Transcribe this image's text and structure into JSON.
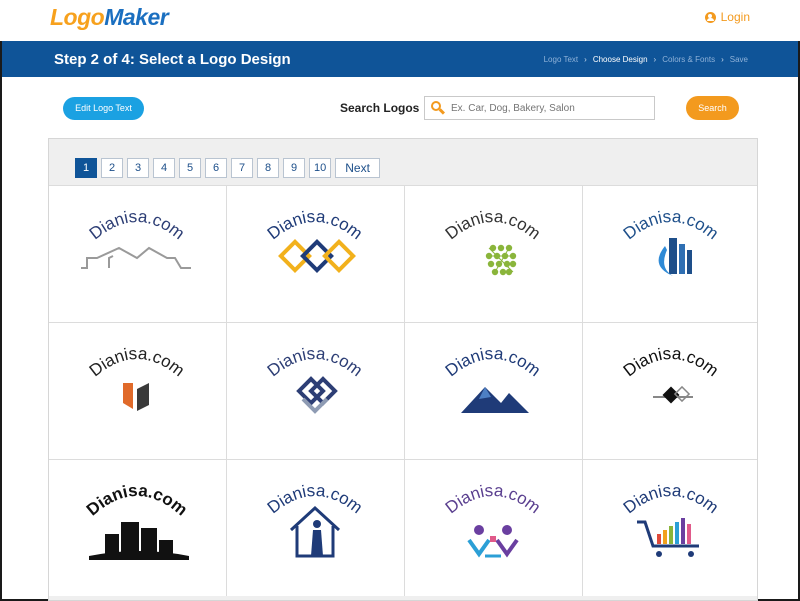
{
  "header": {
    "logo_part1": "Logo",
    "logo_part2": "Maker",
    "login_label": "Login"
  },
  "banner": {
    "title": "Step 2 of 4: Select a Logo Design",
    "steps": [
      "Logo Text",
      "Choose Design",
      "Colors & Fonts",
      "Save"
    ],
    "active_step": "Choose Design"
  },
  "toolbar": {
    "edit_label": "Edit Logo Text",
    "search_label": "Search Logos",
    "search_placeholder": "Ex. Car, Dog, Bakery, Salon",
    "search_value": "",
    "search_button": "Search"
  },
  "pagination": {
    "pages": [
      "1",
      "2",
      "3",
      "4",
      "5",
      "6",
      "7",
      "8",
      "9",
      "10"
    ],
    "current": "1",
    "next_label": "Next"
  },
  "logos": [
    {
      "text": "Dianisa.com",
      "style": "houses",
      "color": "#2d3e75"
    },
    {
      "text": "Dianisa.com",
      "style": "diamonds",
      "color": "#1f3b78"
    },
    {
      "text": "Dianisa.com",
      "style": "globe-dots",
      "color": "#333333"
    },
    {
      "text": "Dianisa.com",
      "style": "building-swoosh",
      "color": "#1e4f8a"
    },
    {
      "text": "Dianisa.com",
      "style": "orange-blocks",
      "color": "#222222"
    },
    {
      "text": "Dianisa.com",
      "style": "knot",
      "color": "#2d3e75"
    },
    {
      "text": "Dianisa.com",
      "style": "mountains",
      "color": "#1f3b78"
    },
    {
      "text": "Dianisa.com",
      "style": "diamond-line",
      "color": "#111111"
    },
    {
      "text": "Dianisa.com",
      "style": "skyline",
      "color": "#111111"
    },
    {
      "text": "Dianisa.com",
      "style": "house-figure",
      "color": "#1f3b78"
    },
    {
      "text": "Dianisa.com",
      "style": "people",
      "color": "#5a3f8f"
    },
    {
      "text": "Dianisa.com",
      "style": "cart",
      "color": "#1f3b78"
    }
  ]
}
